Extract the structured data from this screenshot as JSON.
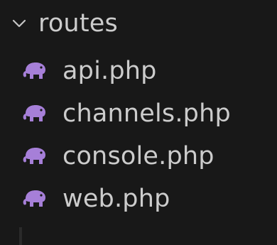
{
  "explorer": {
    "folder": {
      "label": "routes",
      "icon": "chevron-down-icon",
      "expanded": true
    },
    "files": [
      {
        "label": "api.php",
        "icon": "php-elephant-icon"
      },
      {
        "label": "channels.php",
        "icon": "php-elephant-icon"
      },
      {
        "label": "console.php",
        "icon": "php-elephant-icon"
      },
      {
        "label": "web.php",
        "icon": "php-elephant-icon"
      }
    ],
    "colors": {
      "background": "#181818",
      "text": "#cccccc",
      "php_icon": "#a67fd8"
    }
  }
}
